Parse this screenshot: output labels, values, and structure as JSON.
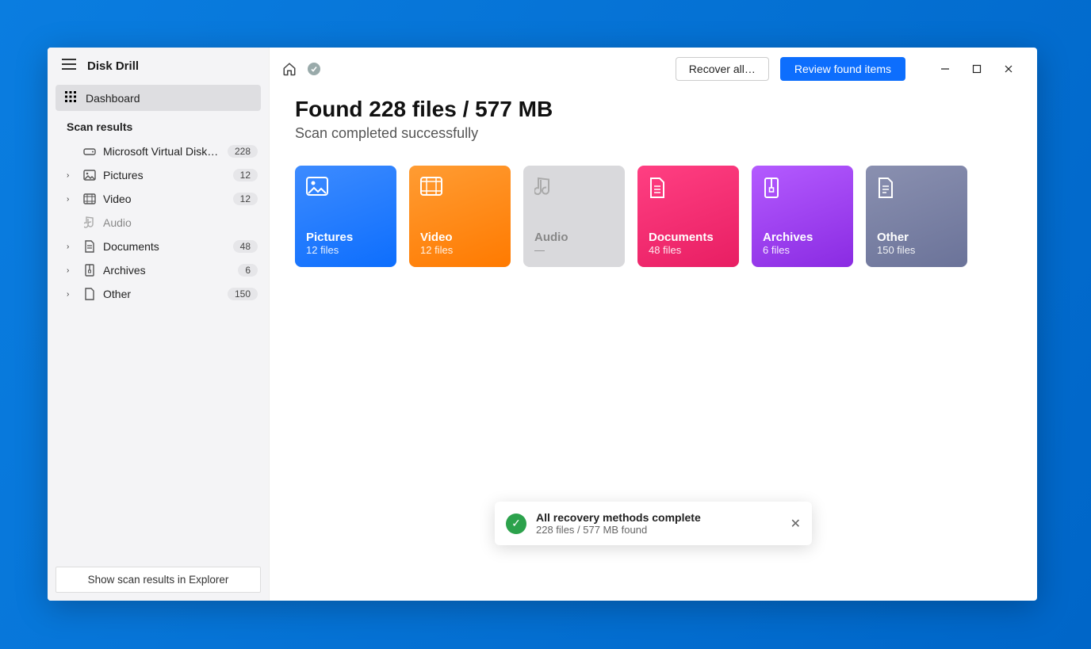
{
  "app": {
    "title": "Disk Drill"
  },
  "sidebar": {
    "dashboard_label": "Dashboard",
    "section_label": "Scan results",
    "items": [
      {
        "label": "Microsoft Virtual Disk.d…",
        "count": "228",
        "icon": "drive",
        "expandable": false
      },
      {
        "label": "Pictures",
        "count": "12",
        "icon": "pictures",
        "expandable": true
      },
      {
        "label": "Video",
        "count": "12",
        "icon": "video",
        "expandable": true
      },
      {
        "label": "Audio",
        "count": "",
        "icon": "audio",
        "expandable": false,
        "dim": true
      },
      {
        "label": "Documents",
        "count": "48",
        "icon": "documents",
        "expandable": true
      },
      {
        "label": "Archives",
        "count": "6",
        "icon": "archives",
        "expandable": true
      },
      {
        "label": "Other",
        "count": "150",
        "icon": "other",
        "expandable": true
      }
    ],
    "footer_button": "Show scan results in Explorer"
  },
  "topbar": {
    "recover_label": "Recover all…",
    "review_label": "Review found items"
  },
  "main": {
    "headline": "Found 228 files / 577 MB",
    "subline": "Scan completed successfully",
    "cards": [
      {
        "title": "Pictures",
        "count": "12 files",
        "class": "c-blue"
      },
      {
        "title": "Video",
        "count": "12 files",
        "class": "c-orange"
      },
      {
        "title": "Audio",
        "count": "—",
        "class": "c-grey"
      },
      {
        "title": "Documents",
        "count": "48 files",
        "class": "c-pink"
      },
      {
        "title": "Archives",
        "count": "6 files",
        "class": "c-purple"
      },
      {
        "title": "Other",
        "count": "150 files",
        "class": "c-slate"
      }
    ]
  },
  "toast": {
    "title": "All recovery methods complete",
    "subtitle": "228 files / 577 MB found"
  }
}
